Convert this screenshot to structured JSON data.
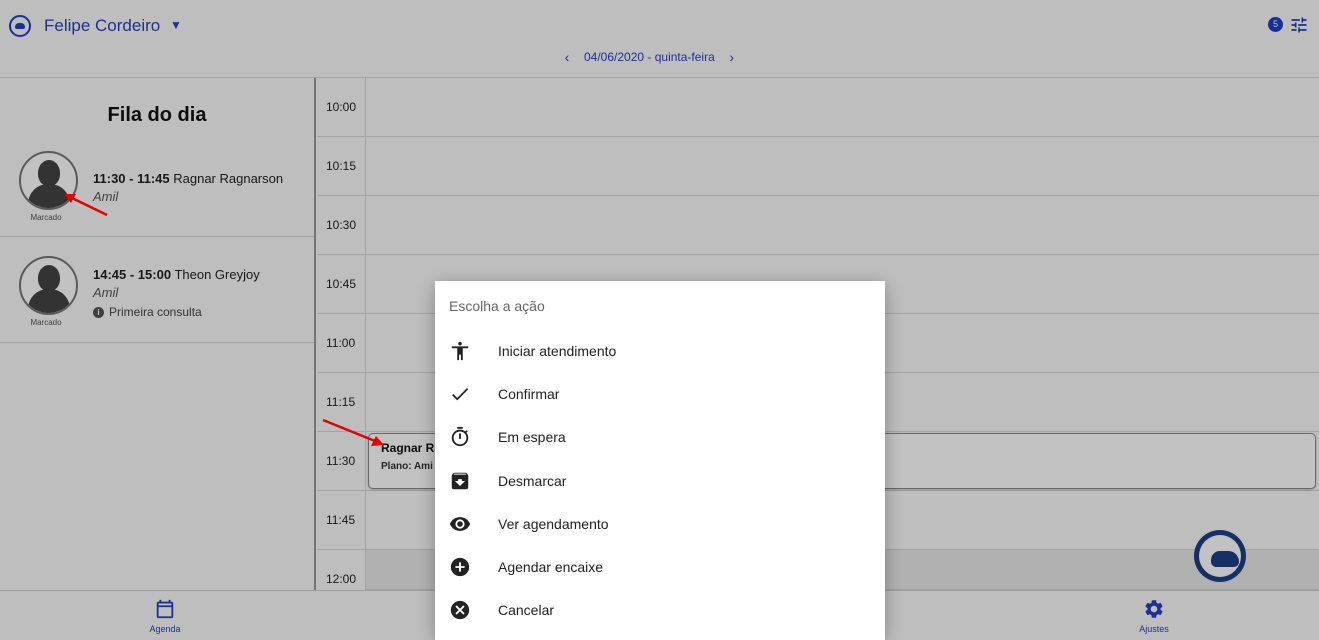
{
  "header": {
    "user_name": "Felipe Cordeiro",
    "badge_count": "5",
    "date_label": "04/06/2020 - quinta-feira",
    "accent_color": "#2a3fc0"
  },
  "queue": {
    "title": "Fila do dia",
    "items": [
      {
        "time": "11:30 - 11:45",
        "name": "Ragnar Ragnarson",
        "plan": "Amil",
        "status": "Marcado",
        "note": ""
      },
      {
        "time": "14:45 - 15:00",
        "name": "Theon Greyjoy",
        "plan": "Amil",
        "status": "Marcado",
        "note": "Primeira consulta"
      }
    ]
  },
  "schedule": {
    "slots": [
      "10:00",
      "10:15",
      "10:30",
      "10:45",
      "11:00",
      "11:15",
      "11:30",
      "11:45",
      "12:00"
    ],
    "appointment": {
      "name": "Ragnar Ra",
      "plan": "Plano: Ami"
    }
  },
  "dialog": {
    "title": "Escolha a ação",
    "actions": [
      {
        "label": "Iniciar atendimento",
        "icon": "person-icon"
      },
      {
        "label": "Confirmar",
        "icon": "check-icon"
      },
      {
        "label": "Em espera",
        "icon": "timer-icon"
      },
      {
        "label": "Desmarcar",
        "icon": "archive-icon"
      },
      {
        "label": "Ver agendamento",
        "icon": "eye-icon"
      },
      {
        "label": "Agendar encaixe",
        "icon": "add-circle-icon"
      },
      {
        "label": "Cancelar",
        "icon": "cancel-circle-icon"
      }
    ]
  },
  "bottom_nav": {
    "agenda": "Agenda",
    "ajustes": "Ajustes"
  }
}
